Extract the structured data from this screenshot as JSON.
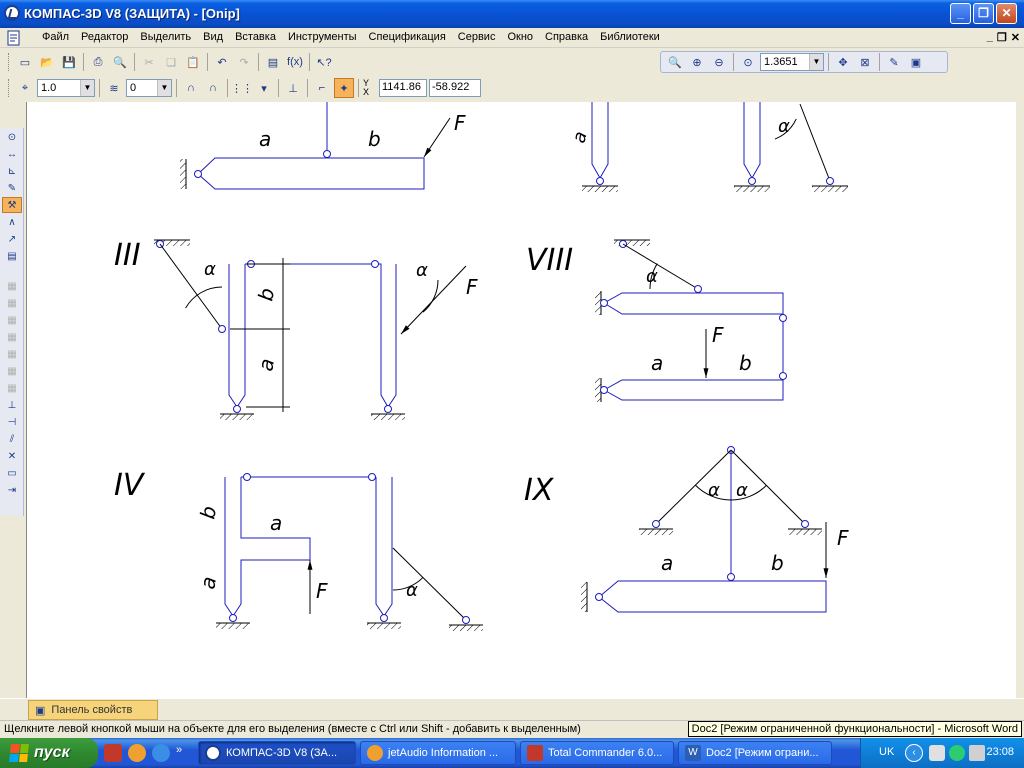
{
  "window": {
    "title": "КОМПАС-3D V8 (ЗАЩИТА) - [Onip]",
    "minimize": "_",
    "maximize": "❐",
    "close": "✕"
  },
  "menu": {
    "items": [
      "Файл",
      "Редактор",
      "Выделить",
      "Вид",
      "Вставка",
      "Инструменты",
      "Спецификация",
      "Сервис",
      "Окно",
      "Справка",
      "Библиотеки"
    ],
    "mdi_min": "_",
    "mdi_restore": "❐",
    "mdi_close": "✕"
  },
  "toolbar_view": {
    "zoom_value": "1.3651"
  },
  "toolbar_current": {
    "scale_value": "1.0",
    "layer_value": "0",
    "x_label": "Y",
    "x_sub": "X",
    "coord_x": "1141.86",
    "coord_y": "-58.922"
  },
  "drawing": {
    "roman": {
      "iii": "III",
      "viii": "VIII",
      "iv": "IV",
      "ix": "IX"
    },
    "a": "a",
    "b": "b",
    "F": "F",
    "alpha": "α"
  },
  "property_panel": {
    "tab_label": "Панель свойств"
  },
  "status": {
    "message": "Щелкните левой кнопкой мыши на объекте для его выделения (вместе с Ctrl или Shift - добавить к выделенным)",
    "tooltip": "Doc2 [Режим ограниченной функциональности] - Microsoft Word"
  },
  "taskbar": {
    "start_label": "пуск",
    "quick_more": "»",
    "tasks": [
      {
        "label": "КОМПАС-3D V8 (ЗА..."
      },
      {
        "label": "jetAudio Information ..."
      },
      {
        "label": "Total Commander 6.0..."
      },
      {
        "label": "Doc2 [Режим ограни..."
      }
    ],
    "language": "UK",
    "clock": "23:08"
  },
  "colors": {
    "line_blue": "#1c1cbf",
    "line_black": "#000000",
    "titlebar": "#0853d4"
  }
}
